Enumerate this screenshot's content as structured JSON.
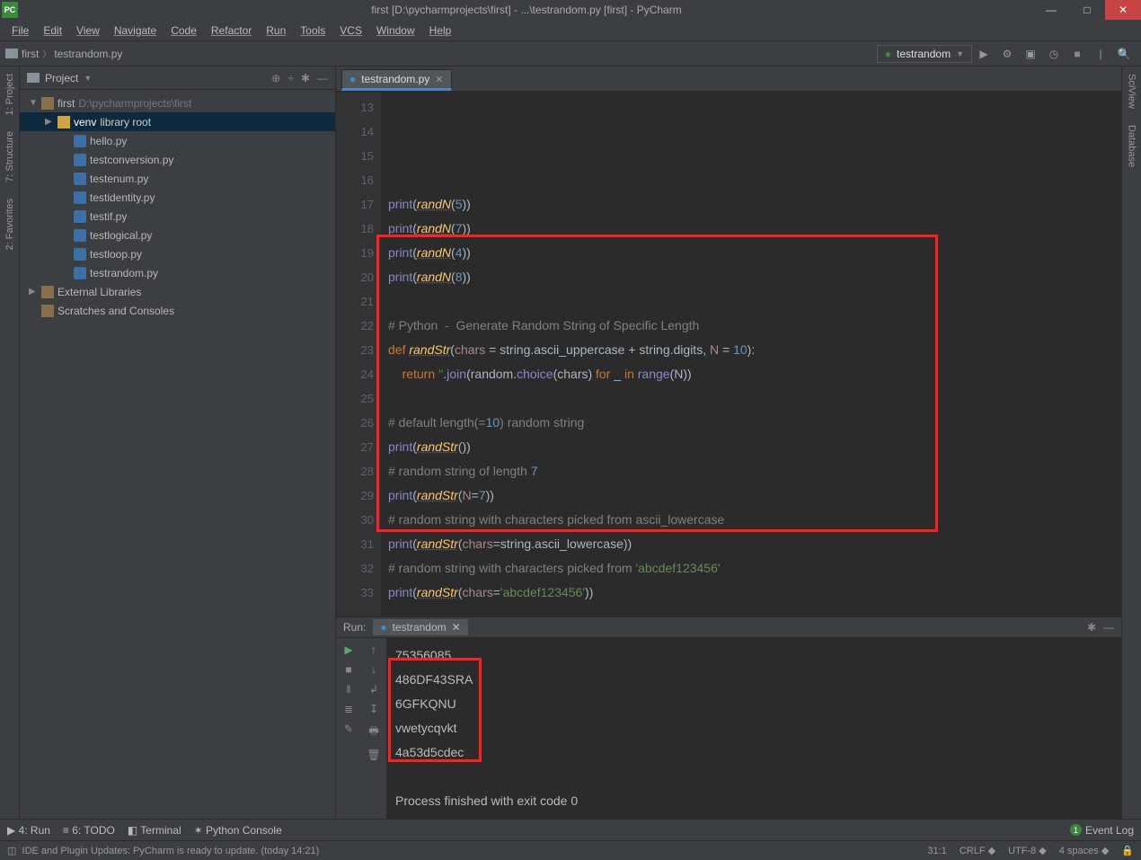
{
  "title": "first [D:\\pycharmprojects\\first] - ...\\testrandom.py [first] - PyCharm",
  "app_icon": "PC",
  "menus": [
    "File",
    "Edit",
    "View",
    "Navigate",
    "Code",
    "Refactor",
    "Run",
    "Tools",
    "VCS",
    "Window",
    "Help"
  ],
  "breadcrumb": {
    "root": "first",
    "file": "testrandom.py"
  },
  "run_config": "testrandom",
  "project_panel": {
    "title": "Project",
    "tree": [
      {
        "indent": 0,
        "arrow": "▼",
        "icon": "folder",
        "label": "first",
        "suffix": " D:\\pycharmprojects\\first"
      },
      {
        "indent": 1,
        "arrow": "▶",
        "icon": "lib",
        "label": "venv",
        "suffix": " library root",
        "sel": true
      },
      {
        "indent": 2,
        "arrow": "",
        "icon": "py",
        "label": "hello.py"
      },
      {
        "indent": 2,
        "arrow": "",
        "icon": "py",
        "label": "testconversion.py"
      },
      {
        "indent": 2,
        "arrow": "",
        "icon": "py",
        "label": "testenum.py"
      },
      {
        "indent": 2,
        "arrow": "",
        "icon": "py",
        "label": "testidentity.py"
      },
      {
        "indent": 2,
        "arrow": "",
        "icon": "py",
        "label": "testif.py"
      },
      {
        "indent": 2,
        "arrow": "",
        "icon": "py",
        "label": "testlogical.py"
      },
      {
        "indent": 2,
        "arrow": "",
        "icon": "py",
        "label": "testloop.py"
      },
      {
        "indent": 2,
        "arrow": "",
        "icon": "py",
        "label": "testrandom.py"
      },
      {
        "indent": 0,
        "arrow": "▶",
        "icon": "extlib",
        "label": "External Libraries"
      },
      {
        "indent": 0,
        "arrow": "",
        "icon": "scratch",
        "label": "Scratches and Consoles"
      }
    ]
  },
  "editor": {
    "tab": "testrandom.py",
    "first_line_no": 13,
    "lines": [
      "",
      "print(randN(5))",
      "print(randN(7))",
      "print(randN(4))",
      "print(randN(8))",
      "",
      "# Python  -  Generate Random String of Specific Length",
      "def randStr(chars = string.ascii_uppercase + string.digits, N = 10):",
      "    return ''.join(random.choice(chars) for _ in range(N))",
      "",
      "# default length(=10) random string",
      "print(randStr())",
      "# random string of length 7",
      "print(randStr(N=7))",
      "# random string with characters picked from ascii_lowercase",
      "print(randStr(chars=string.ascii_lowercase))",
      "# random string with characters picked from 'abcdef123456'",
      "print(randStr(chars='abcdef123456'))",
      "",
      "",
      ""
    ]
  },
  "run": {
    "label": "Run:",
    "tab": "testrandom",
    "output": [
      "75356085",
      "486DF43SRA",
      "6GFKQNU",
      "vwetycqvkt",
      "4a53d5cdec",
      "",
      "Process finished with exit code 0"
    ]
  },
  "bottom_tabs": [
    "▶ 4: Run",
    "≡ 6: TODO",
    "◧ Terminal",
    "✶ Python Console"
  ],
  "event_log": "Event Log",
  "leftrail": [
    "1: Project",
    "7: Structure",
    "2: Favorites"
  ],
  "rightrail": [
    "SciView",
    "Database"
  ],
  "status": {
    "msg": "IDE and Plugin Updates: PyCharm is ready to update. (today 14:21)",
    "pos": "31:1",
    "eol": "CRLF",
    "enc": "UTF-8",
    "indent": "4 spaces"
  }
}
